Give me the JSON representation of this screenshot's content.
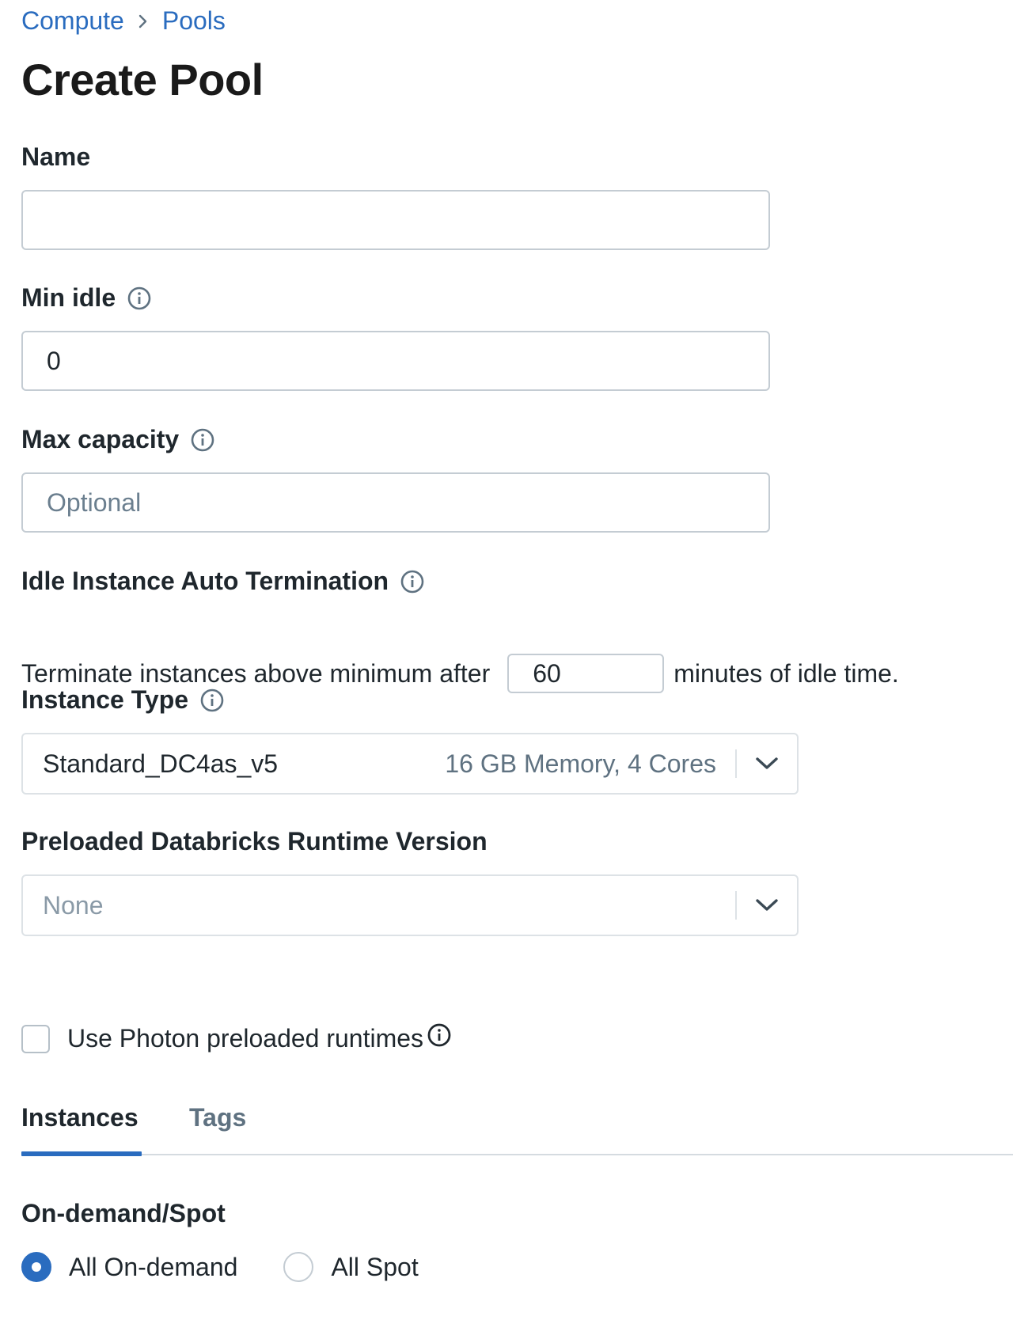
{
  "breadcrumb": {
    "items": [
      "Compute",
      "Pools"
    ]
  },
  "page_title": "Create Pool",
  "fields": {
    "name": {
      "label": "Name",
      "value": "",
      "placeholder": ""
    },
    "min_idle": {
      "label": "Min idle",
      "value": "0",
      "placeholder": ""
    },
    "max_capacity": {
      "label": "Max capacity",
      "value": "",
      "placeholder": "Optional"
    },
    "auto_termination": {
      "label": "Idle Instance Auto Termination",
      "prefix": "Terminate instances above minimum after",
      "value": "60",
      "suffix": "minutes of idle time."
    },
    "instance_type": {
      "label": "Instance Type",
      "value": "Standard_DC4as_v5",
      "description": "16 GB Memory, 4 Cores"
    },
    "runtime_version": {
      "label": "Preloaded Databricks Runtime Version",
      "placeholder": "None"
    },
    "photon": {
      "label": "Use Photon preloaded runtimes",
      "checked": false
    }
  },
  "tabs": [
    {
      "label": "Instances",
      "active": true
    },
    {
      "label": "Tags",
      "active": false
    }
  ],
  "on_demand_spot": {
    "label": "On-demand/Spot",
    "options": [
      {
        "label": "All On-demand",
        "selected": true
      },
      {
        "label": "All Spot",
        "selected": false
      }
    ]
  },
  "colors": {
    "link": "#2a6cbf",
    "text": "#1f272d",
    "muted": "#5f7281",
    "border": "#c4ccd3",
    "accent": "#2a6cbf"
  },
  "icons": {
    "info": "info-circle-icon",
    "chevron": "chevron-down-icon",
    "separator": "chevron-right-icon"
  }
}
